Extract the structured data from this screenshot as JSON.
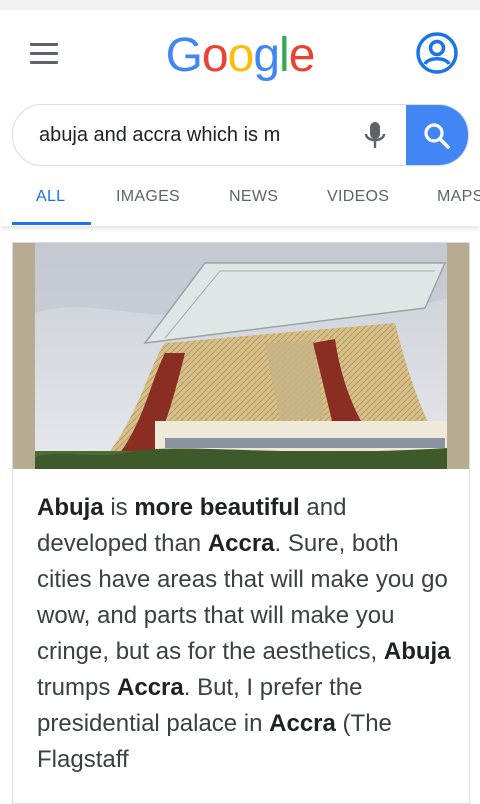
{
  "header": {
    "logo_text": "Google",
    "logo_colors": [
      "#4285F4",
      "#EA4335",
      "#FBBC05",
      "#4285F4",
      "#34A853",
      "#EA4335"
    ],
    "menu_icon": "hamburger-menu-icon",
    "account_icon": "account-circle-icon"
  },
  "search": {
    "query": "abuja and accra which is m",
    "mic_icon": "microphone-icon",
    "search_icon": "magnifier-icon",
    "accent_color": "#4285F4"
  },
  "tabs": [
    {
      "label": "ALL",
      "active": true
    },
    {
      "label": "IMAGES",
      "active": false
    },
    {
      "label": "NEWS",
      "active": false
    },
    {
      "label": "VIDEOS",
      "active": false
    },
    {
      "label": "MAPS",
      "active": false
    }
  ],
  "result": {
    "image_subject": "flagstaff-house-presidential-palace-image",
    "snippet": [
      {
        "text": "Abuja",
        "bold": true
      },
      {
        "text": " is ",
        "bold": false
      },
      {
        "text": "more beautiful",
        "bold": true
      },
      {
        "text": " and developed than ",
        "bold": false
      },
      {
        "text": "Accra",
        "bold": true
      },
      {
        "text": ". Sure, both cities have areas that will make you go wow, and parts that will make you cringe, but as for the aesthetics, ",
        "bold": false
      },
      {
        "text": "Abuja",
        "bold": true
      },
      {
        "text": " trumps ",
        "bold": false
      },
      {
        "text": "Accra",
        "bold": true
      },
      {
        "text": ". But, I prefer the presidential palace in ",
        "bold": false
      },
      {
        "text": "Accra",
        "bold": true
      },
      {
        "text": " (The Flagstaff",
        "bold": false
      }
    ]
  }
}
